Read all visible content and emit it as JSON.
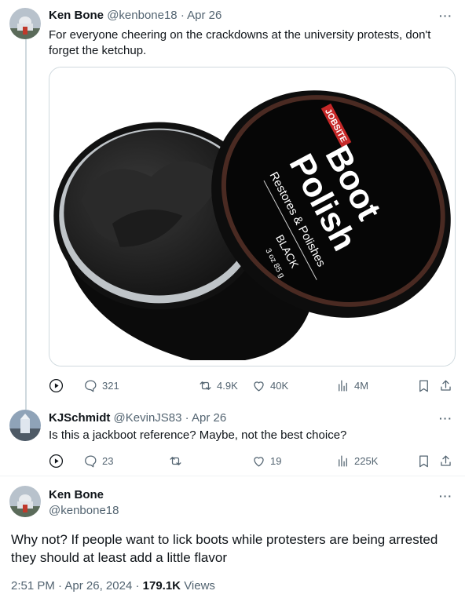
{
  "tweet1": {
    "name": "Ken Bone",
    "handle": "@kenbone18",
    "dot": "·",
    "date": "Apr 26",
    "text_line1": "For everyone cheering on the crackdowns at the university protests, don't",
    "text_line2": "forget the ketchup.",
    "media": {
      "brand": "JOBSITE",
      "title1": "Boot",
      "title2": "Polish",
      "subtitle": "Restores & Polishes",
      "color": "BLACK",
      "weight": "3 oz 85 g"
    },
    "replies": "321",
    "reposts": "4.9K",
    "likes": "40K",
    "views": "4M"
  },
  "tweet2": {
    "name": "KJSchmidt",
    "handle": "@KevinJS83",
    "dot": "·",
    "date": "Apr 26",
    "text": "Is this a jackboot reference? Maybe, not the best choice?",
    "replies": "23",
    "reposts": "",
    "likes": "19",
    "views": "225K"
  },
  "main": {
    "name": "Ken Bone",
    "handle": "@kenbone18",
    "text_line1": "Why not? If people want to lick boots while protesters are being arrested",
    "text_line2": "they should at least add a little flavor",
    "time": "2:51 PM",
    "dot": "·",
    "date": "Apr 26, 2024",
    "dot2": "·",
    "views_count": "179.1K",
    "views_label": "Views"
  },
  "more_label": "···"
}
